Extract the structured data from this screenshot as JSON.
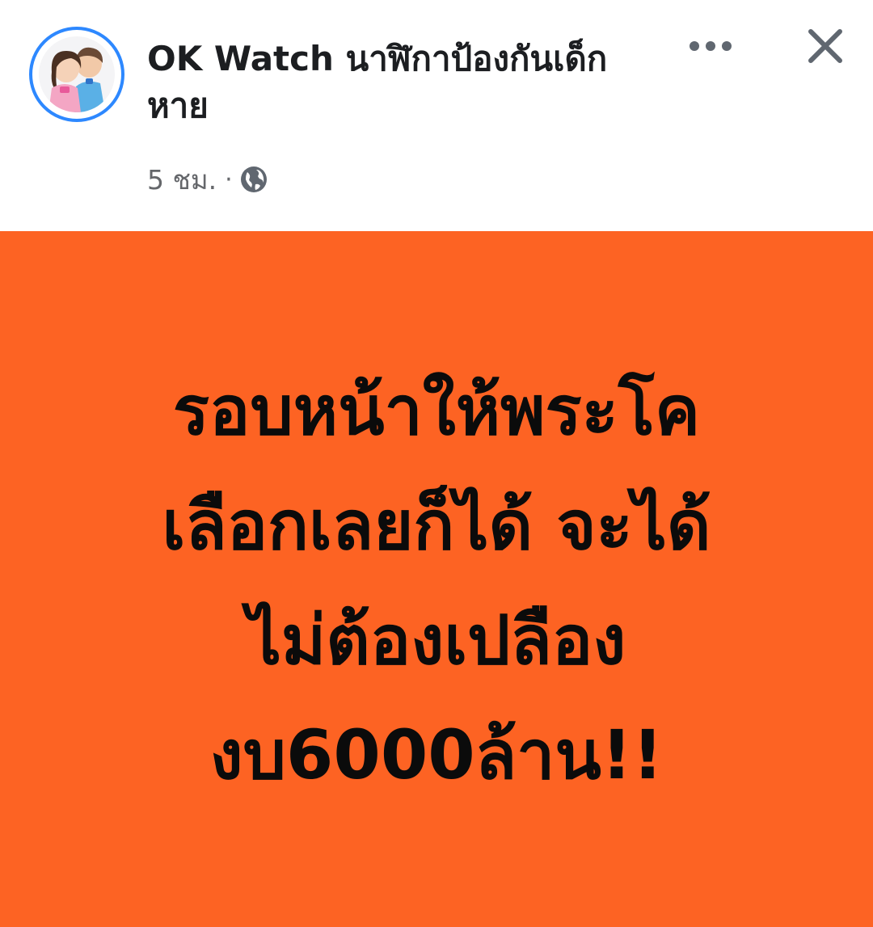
{
  "post": {
    "page_name": "OK Watch นาฬิกาป้องกันเด็กหาย",
    "timestamp": "5 ชม.",
    "separator": "·",
    "audience_icon": "globe-icon",
    "more_icon": "more-horizontal-icon",
    "close_icon": "close-icon",
    "image_text_lines": [
      "รอบหน้าให้พระโค",
      "เลือกเลยก็ได้ จะได้",
      "ไม่ต้องเปลือง",
      "งบ6000ล้าน!!"
    ],
    "colors": {
      "image_background": "#fd6323",
      "avatar_ring": "#2d88ff",
      "meta_text": "#65676b",
      "icon_gray": "#606770"
    }
  }
}
